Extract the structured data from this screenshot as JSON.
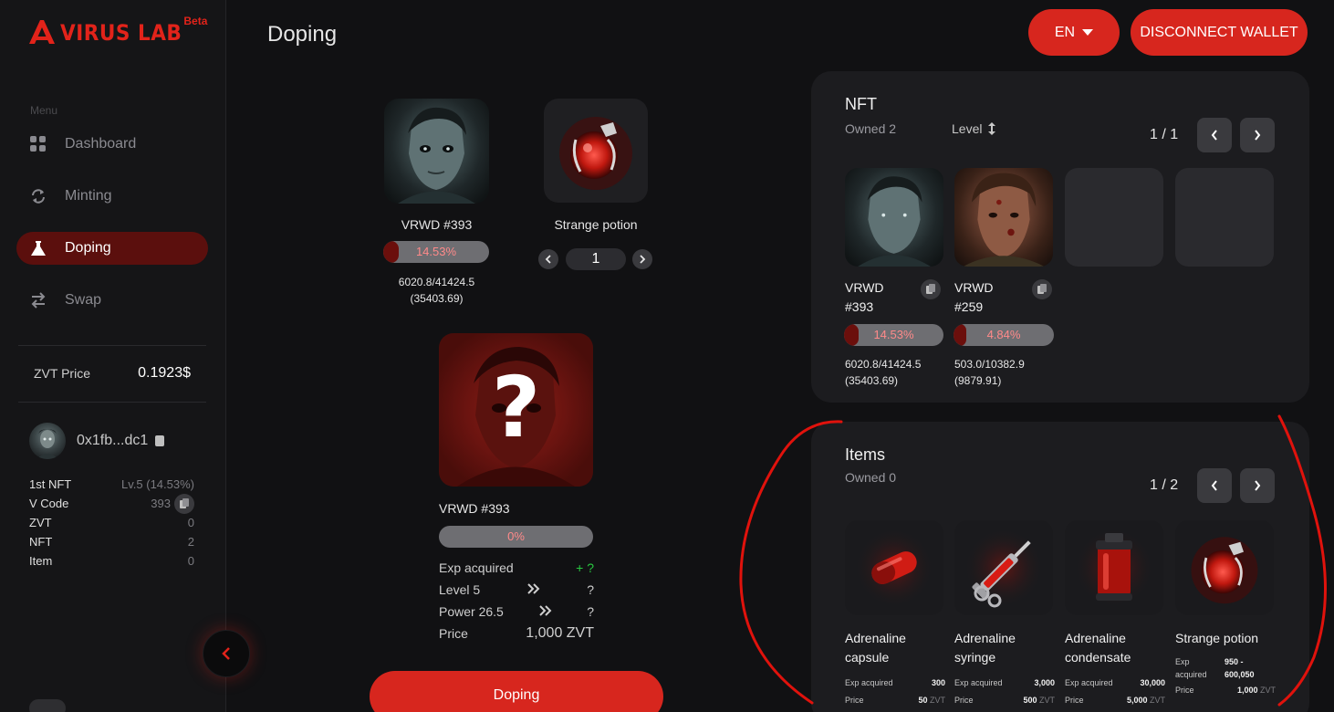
{
  "brand": {
    "name": "VIRUS LAB",
    "beta": "Beta"
  },
  "sidebar": {
    "menu_label": "Menu",
    "items": [
      {
        "label": "Dashboard",
        "icon": "grid-icon",
        "active": false
      },
      {
        "label": "Minting",
        "icon": "refresh-icon",
        "active": false
      },
      {
        "label": "Doping",
        "icon": "flask-icon",
        "active": true
      },
      {
        "label": "Swap",
        "icon": "swap-icon",
        "active": false
      }
    ],
    "zvt_price_label": "ZVT Price",
    "zvt_price_value": "0.1923$",
    "wallet_address": "0x1fb...dc1",
    "stats": {
      "first_nft_label": "1st NFT",
      "first_nft_value": "Lv.5 (14.53%)",
      "vcode_label": "V Code",
      "vcode_value": "393",
      "zvt_label": "ZVT",
      "zvt_value": "0",
      "nft_label": "NFT",
      "nft_value": "2",
      "item_label": "Item",
      "item_value": "0"
    }
  },
  "header": {
    "title": "Doping",
    "lang_button": "EN",
    "disconnect_button": "DISCONNECT WALLET"
  },
  "doping": {
    "source_nft": {
      "name": "VRWD #393",
      "percent_label": "14.53%",
      "percent": 14.53,
      "exp_line1": "6020.8/41424.5",
      "exp_line2": "(35403.69)"
    },
    "item": {
      "name": "Strange potion",
      "quantity": "1"
    },
    "result": {
      "name": "VRWD #393",
      "question_mark": "?",
      "percent_label": "0%",
      "percent": 0,
      "exp_label": "Exp acquired",
      "exp_value_plus": "+",
      "exp_value": "?",
      "level_label": "Level 5",
      "level_value": "?",
      "power_label": "Power 26.5",
      "power_value": "?",
      "price_label": "Price",
      "price_value": "1,000 ZVT"
    },
    "button": "Doping"
  },
  "nft_panel": {
    "title": "NFT",
    "owned": "Owned 2",
    "sort_label": "Level",
    "pager": "1 / 1",
    "cards": [
      {
        "name_line1": "VRWD",
        "name_line2": "#393",
        "percent_label": "14.53%",
        "percent": 14.53,
        "exp_line1": "6020.8/41424.5",
        "exp_line2": "(35403.69)"
      },
      {
        "name_line1": "VRWD",
        "name_line2": "#259",
        "percent_label": "4.84%",
        "percent": 4.84,
        "exp_line1": "503.0/10382.9",
        "exp_line2": "(9879.91)"
      }
    ]
  },
  "items_panel": {
    "title": "Items",
    "owned": "Owned 0",
    "pager": "1 / 2",
    "exp_label": "Exp acquired",
    "exp_label_wrapped_1": "Exp",
    "exp_label_wrapped_2": "acquired",
    "price_label": "Price",
    "unit": "ZVT",
    "items": [
      {
        "name_line1": "Adrenaline",
        "name_line2": "capsule",
        "exp": "300",
        "price": "50"
      },
      {
        "name_line1": "Adrenaline",
        "name_line2": "syringe",
        "exp": "3,000",
        "price": "500"
      },
      {
        "name_line1": "Adrenaline",
        "name_line2": "condensate",
        "exp": "30,000",
        "price": "5,000"
      },
      {
        "name_line1": "Strange potion",
        "name_line2": "",
        "exp_line1": "950 -",
        "exp_line2": "600,050",
        "price": "1,000"
      }
    ]
  },
  "colors": {
    "accent": "#d7261e",
    "dark_red": "#6b0f0c",
    "panel": "#1c1c1f",
    "bg": "#111113"
  }
}
